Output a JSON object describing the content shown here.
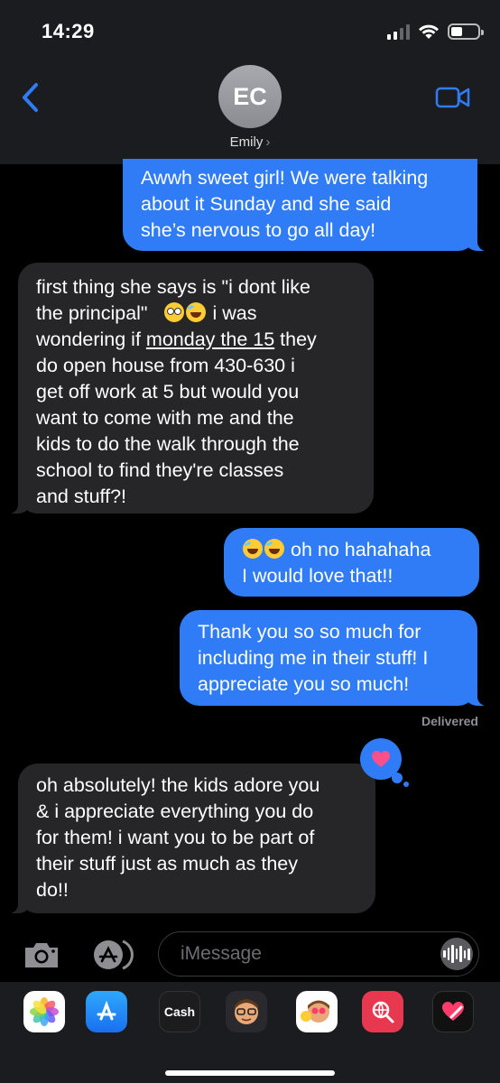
{
  "status_bar": {
    "time": "14:29"
  },
  "header": {
    "avatar_initials": "EC",
    "contact_name": "Emily",
    "back_icon": "chevron-left-icon",
    "video_icon": "video-camera-icon",
    "accent_color": "#2f7cf6"
  },
  "messages": [
    {
      "direction": "sent",
      "lines": [
        "Awwh sweet girl! We were talking",
        "about it Sunday and she said",
        "she’s nervous to go all day!"
      ]
    },
    {
      "direction": "received",
      "line1": "first thing she says is \"i dont like",
      "line2_text": "the principal\"",
      "line2_after": "i was",
      "line3_before": "wondering if",
      "line3_link": "monday the 15",
      "line3_after": "they",
      "line4": "do open house from 430-630 i",
      "line5": "get off work at 5 but would you",
      "line6": "want to come with me and the",
      "line7": "kids to do the walk through the",
      "line8": "school to find they're classes",
      "line9": "and stuff?!"
    },
    {
      "direction": "sent",
      "line1_after_emoji": "oh no hahahaha",
      "line2": "I would love that!!"
    },
    {
      "direction": "sent",
      "lines": [
        "Thank you so so much for",
        "including me in their stuff! I",
        "appreciate you so much!"
      ],
      "status": "Delivered"
    },
    {
      "direction": "received",
      "tapback": "heart-icon",
      "lines": [
        "oh absolutely! the kids adore you",
        "& i appreciate everything you do",
        "for them! i want you to be part of",
        "their stuff just as much as they",
        "do!!"
      ]
    }
  ],
  "composer": {
    "placeholder": "iMessage",
    "camera_icon": "camera-icon",
    "apps_icon": "app-store-icon",
    "voice_icon": "waveform-icon"
  },
  "app_drawer": {
    "apps": [
      {
        "icon": "photos-icon"
      },
      {
        "icon": "app-store-icon"
      },
      {
        "label": "Cash",
        "icon": "apple-cash-icon"
      },
      {
        "icon": "memoji-icon"
      },
      {
        "icon": "memoji-stickers-icon"
      },
      {
        "icon": "web-search-icon"
      },
      {
        "icon": "digital-touch-icon"
      }
    ]
  }
}
